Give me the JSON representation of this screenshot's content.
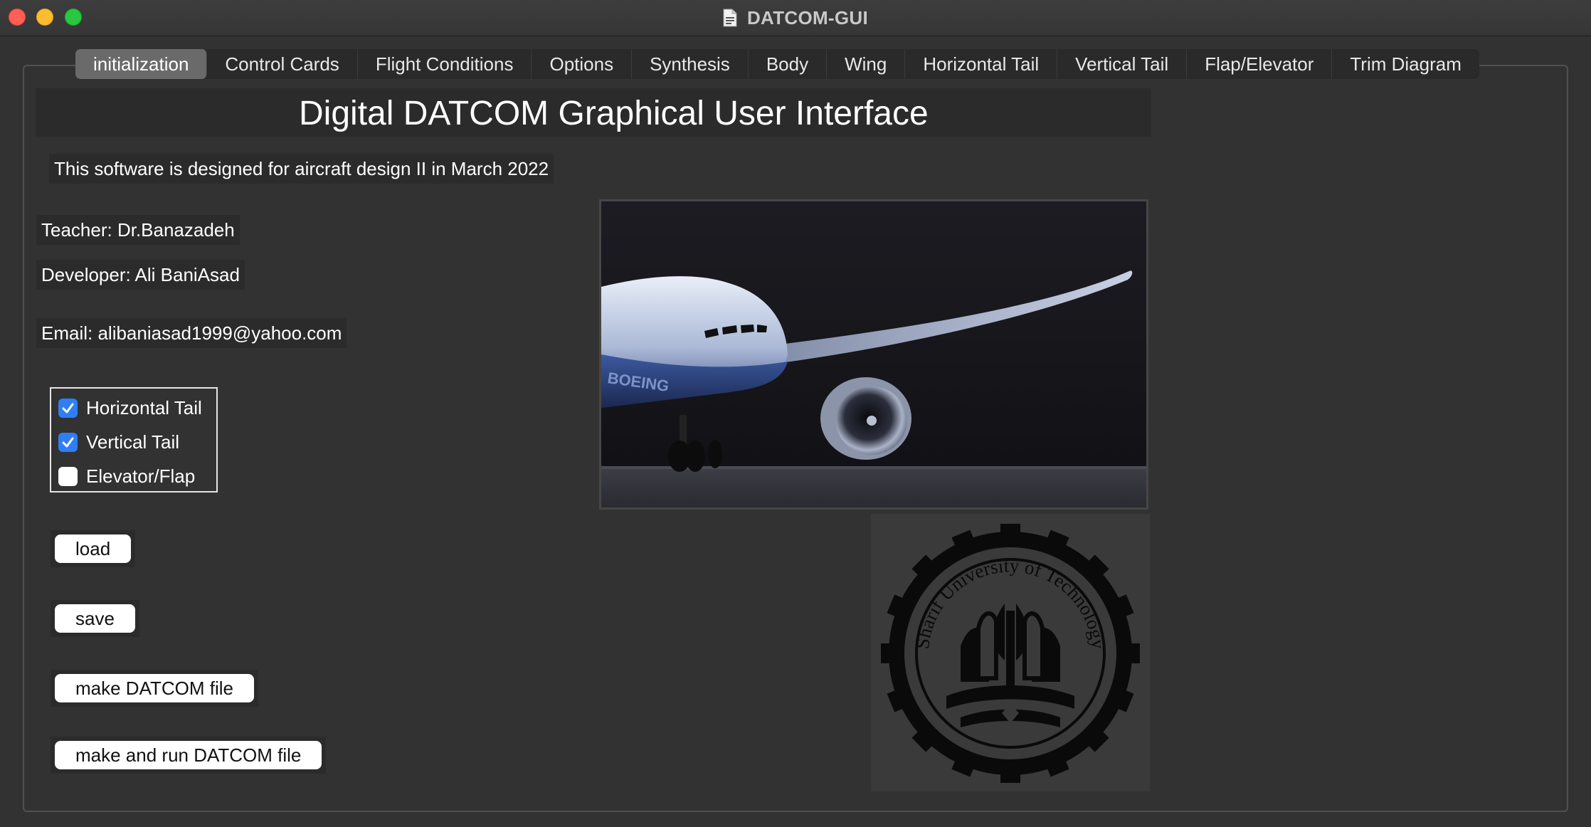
{
  "window": {
    "title": "DATCOM-GUI"
  },
  "tabs": [
    {
      "label": "initialization",
      "active": true
    },
    {
      "label": "Control Cards",
      "active": false
    },
    {
      "label": "Flight Conditions",
      "active": false
    },
    {
      "label": "Options",
      "active": false
    },
    {
      "label": "Synthesis",
      "active": false
    },
    {
      "label": "Body",
      "active": false
    },
    {
      "label": "Wing",
      "active": false
    },
    {
      "label": "Horizontal Tail",
      "active": false
    },
    {
      "label": "Vertical Tail",
      "active": false
    },
    {
      "label": "Flap/Elevator",
      "active": false
    },
    {
      "label": "Trim Diagram",
      "active": false
    }
  ],
  "main": {
    "heading": "Digital DATCOM Graphical User Interface",
    "description": "This software is designed for aircraft design II in March 2022",
    "teacher": "Teacher: Dr.Banazadeh",
    "developer": "Developer: Ali BaniAsad",
    "email": "Email: alibaniasad1999@yahoo.com"
  },
  "checkboxes": [
    {
      "label": "Horizontal Tail",
      "checked": true
    },
    {
      "label": "Vertical Tail",
      "checked": true
    },
    {
      "label": "Elevator/Flap",
      "checked": false
    }
  ],
  "buttons": {
    "load": "load",
    "save": "save",
    "make": "make DATCOM file",
    "make_run": "make and run DATCOM file"
  },
  "images": {
    "aircraft_livery": "BOEING",
    "logo_text": "Sharif University of Technology"
  },
  "colors": {
    "window_bg": "#323232",
    "panel_bg": "#2b2b2b",
    "active_tab": "#6a6a6a",
    "checkbox_on": "#2f7ef6"
  }
}
